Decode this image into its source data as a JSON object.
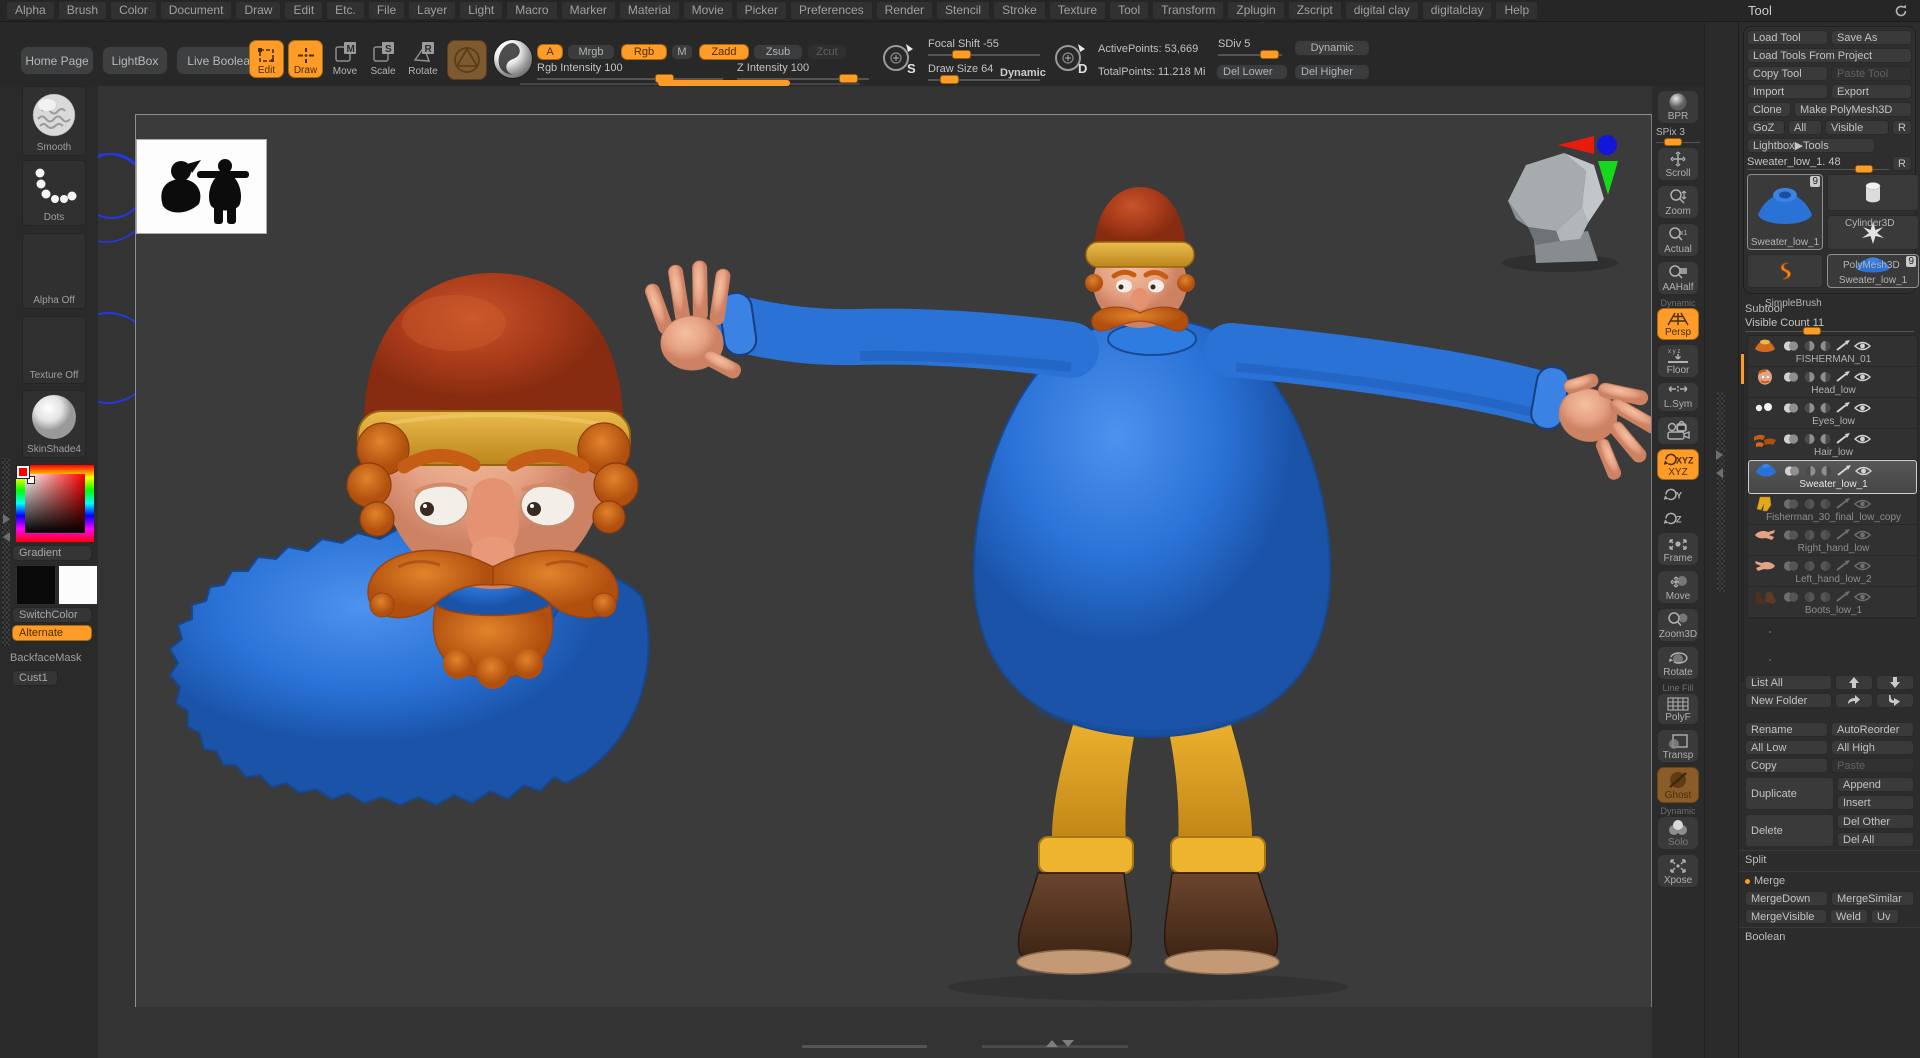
{
  "menu": {
    "items": [
      "Alpha",
      "Brush",
      "Color",
      "Document",
      "Draw",
      "Edit",
      "Etc.",
      "File",
      "Layer",
      "Light",
      "Macro",
      "Marker",
      "Material",
      "Movie",
      "Picker",
      "Preferences",
      "Render",
      "Stencil",
      "Stroke",
      "Texture",
      "Tool",
      "Transform",
      "Zplugin",
      "Zscript",
      "digital clay",
      "digitalclay",
      "Help"
    ]
  },
  "tool_header": {
    "title": "Tool"
  },
  "toolbar": {
    "home_page": "Home Page",
    "lightbox": "LightBox",
    "live_boolean": "Live Boolean",
    "edit": "Edit",
    "draw": "Draw",
    "move": "Move",
    "scale": "Scale",
    "rotate": "Rotate",
    "move_badge": "M",
    "scale_badge": "S",
    "rotate_badge": "R",
    "a": "A",
    "mrgb": "Mrgb",
    "rgb": "Rgb",
    "m": "M",
    "zadd": "Zadd",
    "zsub": "Zsub",
    "zcut": "Zcut",
    "rgb_intensity": "Rgb Intensity 100",
    "z_intensity": "Z Intensity 100",
    "focal_shift": "Focal Shift -55",
    "draw_size": "Draw Size 64",
    "dynamic_label": "Dynamic",
    "stroke_badge": "S",
    "draw_badge": "D",
    "active_points": "ActivePoints: 53,669",
    "total_points": "TotalPoints: 11.218 Mi",
    "sdiv": "SDiv 5",
    "dynamic_button": "Dynamic",
    "del_lower": "Del Lower",
    "del_higher": "Del Higher"
  },
  "left_sidebar": {
    "brush_label": "Smooth",
    "stroke_label": "Dots",
    "alpha_label": "Alpha Off",
    "texture_label": "Texture Off",
    "material_label": "SkinShade4",
    "gradient": "Gradient",
    "switch_color": "SwitchColor",
    "alternate": "Alternate",
    "backface_mask": "BackfaceMask",
    "cust1": "Cust1"
  },
  "right_strip": {
    "items": [
      {
        "label": "BPR",
        "icon": "sphere"
      },
      {
        "label": "SPix 3",
        "type": "slider",
        "pos": 0.3
      },
      {
        "label": "Scroll",
        "icon": "scroll"
      },
      {
        "label": "Zoom",
        "icon": "zoom"
      },
      {
        "label": "Actual",
        "icon": "actual",
        "icon_text": "x1"
      },
      {
        "label": "AAHalf",
        "icon": "aahalf"
      },
      {
        "label": "Persp",
        "icon": "persp",
        "active": true,
        "note": "Dynamic"
      },
      {
        "label": "Floor",
        "icon": "floor",
        "icon_text": "x y z"
      },
      {
        "label": "L.Sym",
        "icon": "lsym"
      },
      {
        "label": "",
        "icon": "camera"
      },
      {
        "label": "XYZ",
        "icon": "spin",
        "icon_text": "XYZ",
        "active": true
      },
      {
        "label": "",
        "icon": "spin",
        "icon_text": "Y",
        "bare": true
      },
      {
        "label": "",
        "icon": "spin",
        "icon_text": "Z",
        "bare": true
      },
      {
        "label": "Frame",
        "icon": "frame"
      },
      {
        "label": "Move",
        "icon": "move3d"
      },
      {
        "label": "Zoom3D",
        "icon": "zoom3d"
      },
      {
        "label": "Rotate",
        "icon": "rotate3d"
      },
      {
        "label": "PolyF",
        "icon": "polyf",
        "note": "Line Fill"
      },
      {
        "label": "Transp",
        "icon": "transp"
      },
      {
        "label": "Ghost",
        "icon": "ghost",
        "ghostly": true
      },
      {
        "label": "Solo",
        "icon": "solo",
        "note": "Dynamic",
        "dim": true
      },
      {
        "label": "Xpose",
        "icon": "xpose"
      }
    ]
  },
  "tool_panel": {
    "load_tool": "Load Tool",
    "save_as": "Save As",
    "load_tools_from_project": "Load Tools From Project",
    "copy_tool": "Copy Tool",
    "paste_tool": "Paste Tool",
    "import": "Import",
    "export": "Export",
    "clone": "Clone",
    "make_polymesh3d": "Make PolyMesh3D",
    "goz": "GoZ",
    "all": "All",
    "visible": "Visible",
    "r": "R",
    "lightbox_tools": "Lightbox▶Tools",
    "active_tool_slider": "Sweater_low_1. 48",
    "r2": "R",
    "thumbs": {
      "big_name": "Sweater_low_1",
      "big_badge": "9",
      "cylinder": "Cylinder3D",
      "polymesh": "PolyMesh3D",
      "simplebrush": "SimpleBrush",
      "small_name": "Sweater_low_1",
      "small_badge": "9"
    }
  },
  "subtool": {
    "title": "Subtool",
    "visible_count": "Visible Count 11",
    "items": [
      {
        "name": "FISHERMAN_01",
        "thumb": "hat",
        "visible": true,
        "selected": false
      },
      {
        "name": "Head_low",
        "thumb": "head",
        "visible": true,
        "selected": false
      },
      {
        "name": "Eyes_low",
        "thumb": "eyes",
        "visible": true,
        "selected": false
      },
      {
        "name": "Hair_low",
        "thumb": "hair",
        "visible": true,
        "selected": false
      },
      {
        "name": "Sweater_low_1",
        "thumb": "sweater",
        "visible": true,
        "selected": true
      },
      {
        "name": "Fisherman_30_final_low_copy",
        "thumb": "pants",
        "visible": false,
        "selected": false
      },
      {
        "name": "Right_hand_low",
        "thumb": "hand",
        "visible": false,
        "selected": false
      },
      {
        "name": "Left_hand_low_2",
        "thumb": "hand2",
        "visible": false,
        "selected": false
      },
      {
        "name": "Boots_low_1",
        "thumb": "boots",
        "visible": false,
        "selected": false
      }
    ],
    "list_all": "List All",
    "new_folder": "New Folder",
    "rename": "Rename",
    "auto_reorder": "AutoReorder",
    "all_low": "All Low",
    "all_high": "All High",
    "copy": "Copy",
    "paste": "Paste",
    "duplicate": "Duplicate",
    "append": "Append",
    "insert": "Insert",
    "delete": "Delete",
    "del_other": "Del Other",
    "del_all": "Del All",
    "split": "Split",
    "merge": "Merge",
    "merge_down": "MergeDown",
    "merge_similar": "MergeSimilar",
    "merge_visible": "MergeVisible",
    "weld": "Weld",
    "uv": "Uv",
    "boolean": "Boolean"
  },
  "colors": {
    "accent_orange": "#ff9c28",
    "panel_bg": "#2c2c2c",
    "canvas_bg": "#3b3b3b",
    "sweater_blue": "#2a72d6",
    "pants_yellow": "#e3a81f",
    "cap_red": "#a73a1a",
    "hair_orange": "#c55d14",
    "skin": "#e5a184",
    "boots_brown": "#4f3120"
  }
}
